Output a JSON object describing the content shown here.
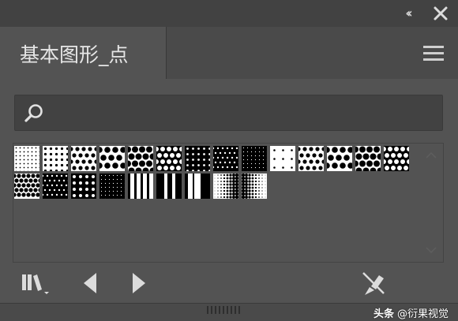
{
  "panel": {
    "tab_title": "基本图形_点",
    "collapse_icon": "double-chevron-left-icon",
    "close_icon": "close-icon",
    "menu_icon": "hamburger-menu-icon"
  },
  "search": {
    "value": "",
    "placeholder": "",
    "icon": "search-icon"
  },
  "swatches": [
    "dot-fine",
    "dot-small",
    "dot-medium",
    "dot-large",
    "dot-xlarge",
    "dot-hex",
    "dot-dark-small",
    "dot-dark-medium",
    "dot-dark-fine",
    "dot-sparse",
    "dot-medium",
    "dot-large",
    "dot-xlarge",
    "dot-hex",
    "dot-hex-dark",
    "dot-dark-medium",
    "dot-dark-large",
    "dot-dark-fine",
    "stripes-vertical",
    "stripes-vertical-wide",
    "stripes-vertical-mixed",
    "gradient-dots-left",
    "gradient-dots-right"
  ],
  "footer": {
    "library_icon": "swatch-library-icon",
    "previous_icon": "triangle-left-icon",
    "next_icon": "triangle-right-icon",
    "break_link_icon": "break-link-icon"
  },
  "watermark": {
    "logo": "头条",
    "handle": "@衍果视觉"
  }
}
